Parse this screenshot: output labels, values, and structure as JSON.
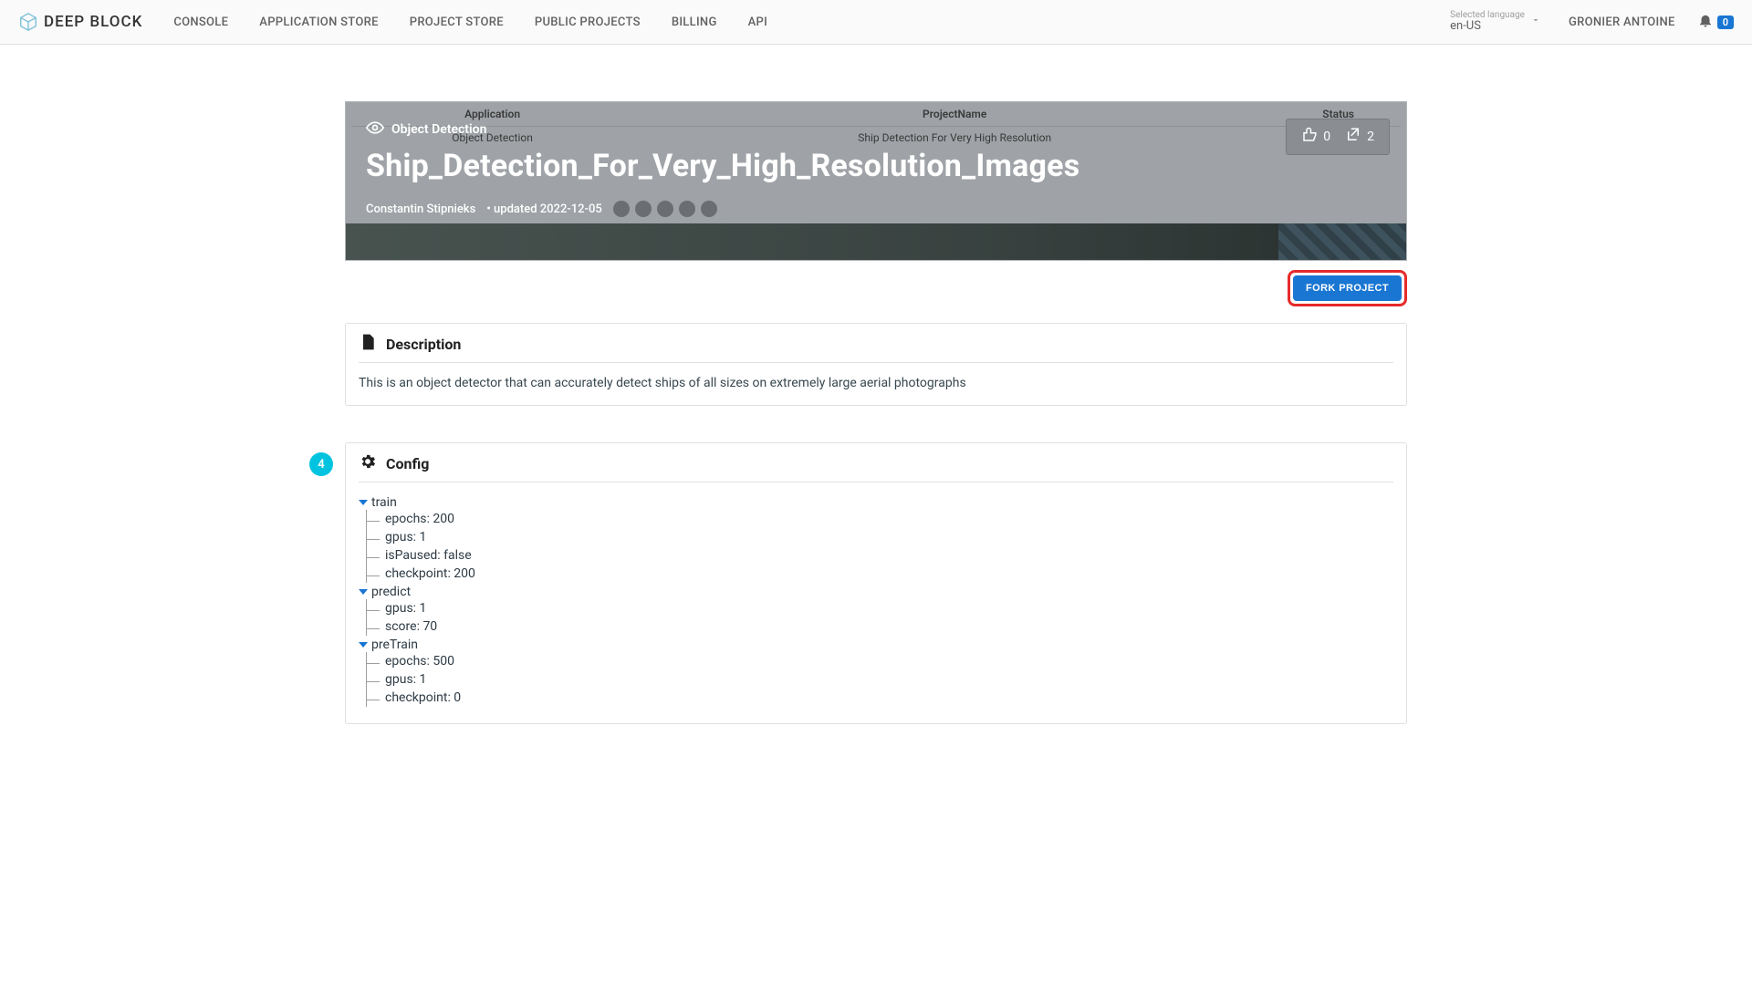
{
  "brand": {
    "name": "DEEP BLOCK"
  },
  "nav": {
    "items": [
      "CONSOLE",
      "APPLICATION STORE",
      "PROJECT STORE",
      "PUBLIC PROJECTS",
      "BILLING",
      "API"
    ]
  },
  "language": {
    "label": "Selected language",
    "value": "en-US"
  },
  "user": {
    "name": "GRONIER ANTOINE"
  },
  "notifications": {
    "count": "0"
  },
  "hero": {
    "table": {
      "headers": [
        "Application",
        "ProjectName",
        "Status"
      ],
      "row": {
        "application": "Object Detection",
        "projectName": "Ship Detection For Very High Resolution"
      }
    },
    "app_type": "Object Detection",
    "title": "Ship_Detection_For_Very_High_Resolution_Images",
    "author": "Constantin Stipnieks",
    "updated_prefix": "• updated ",
    "updated_date": "2022-12-05",
    "likes": "0",
    "forks": "2"
  },
  "fork_button": "FORK PROJECT",
  "description": {
    "title": "Description",
    "body": "This is an object detector that can accurately detect ships of all sizes on extremely large aerial photographs"
  },
  "config": {
    "badge": "4",
    "title": "Config",
    "sections": [
      {
        "name": "train",
        "leaves": [
          "epochs: 200",
          "gpus: 1",
          "isPaused: false",
          "checkpoint: 200"
        ]
      },
      {
        "name": "predict",
        "leaves": [
          "gpus: 1",
          "score: 70"
        ]
      },
      {
        "name": "preTrain",
        "leaves": [
          "epochs: 500",
          "gpus: 1",
          "checkpoint: 0"
        ]
      }
    ]
  }
}
